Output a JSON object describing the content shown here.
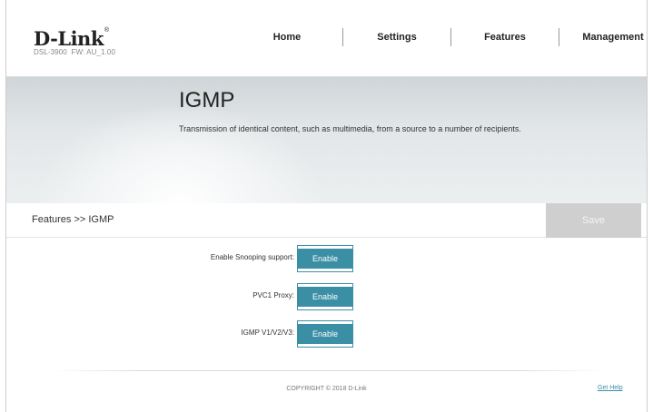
{
  "brand": {
    "logo": "D-Link",
    "model": "DSL-3900",
    "firmware": "FW: AU_1.00"
  },
  "nav": [
    "Home",
    "Settings",
    "Features",
    "Management"
  ],
  "banner": {
    "title": "IGMP",
    "description": "Transmission of identical content, such as multimedia, from a source to a number of recipients."
  },
  "breadcrumb": "Features >> IGMP",
  "save_label": "Save",
  "settings": [
    {
      "label": "Enable Snooping support:",
      "value": "Enable"
    },
    {
      "label": "PVC1 Proxy:",
      "value": "Enable"
    },
    {
      "label": "IGMP V1/V2/V3:",
      "value": "Enable"
    }
  ],
  "footer": {
    "copyright": "COPYRIGHT © 2018 D-Link",
    "help": "Get Help"
  },
  "colors": {
    "accent": "#3a8fa5",
    "save_disabled": "#cfcfcf"
  }
}
